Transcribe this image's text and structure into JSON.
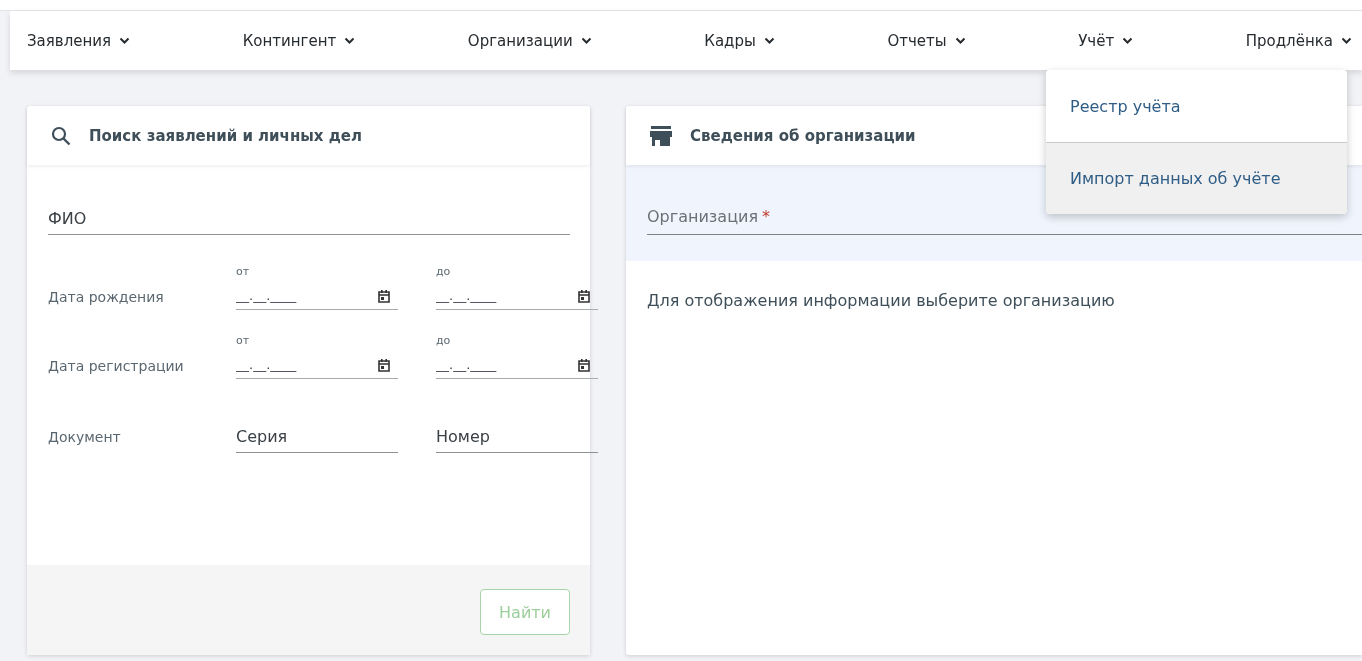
{
  "nav": [
    {
      "label": "Заявления"
    },
    {
      "label": "Контингент"
    },
    {
      "label": "Организации"
    },
    {
      "label": "Кадры"
    },
    {
      "label": "Отчеты"
    },
    {
      "label": "Учёт"
    },
    {
      "label": "Продлёнка"
    }
  ],
  "dropdown": {
    "items": [
      {
        "label": "Реестр учёта",
        "highlighted": false
      },
      {
        "label": "Импорт данных об учёте",
        "highlighted": true
      }
    ]
  },
  "search_card": {
    "title": "Поиск заявлений и личных дел",
    "fio": {
      "placeholder": "ФИО"
    },
    "date_rows": [
      {
        "label": "Дата рождения",
        "from": {
          "caption": "от",
          "placeholder": "__.__.____"
        },
        "to": {
          "caption": "до",
          "placeholder": "__.__.____"
        }
      },
      {
        "label": "Дата регистрации",
        "from": {
          "caption": "от",
          "placeholder": "__.__.____"
        },
        "to": {
          "caption": "до",
          "placeholder": "__.__.____"
        }
      }
    ],
    "document": {
      "label": "Документ",
      "series": {
        "placeholder": "Серия"
      },
      "number": {
        "placeholder": "Номер"
      }
    },
    "find_button": {
      "label": "Найти",
      "disabled": true
    }
  },
  "org_card": {
    "title": "Сведения об организации",
    "field": {
      "label": "Организация",
      "required": true,
      "required_mark": "*"
    },
    "hint": "Для отображения информации выберите организацию"
  }
}
